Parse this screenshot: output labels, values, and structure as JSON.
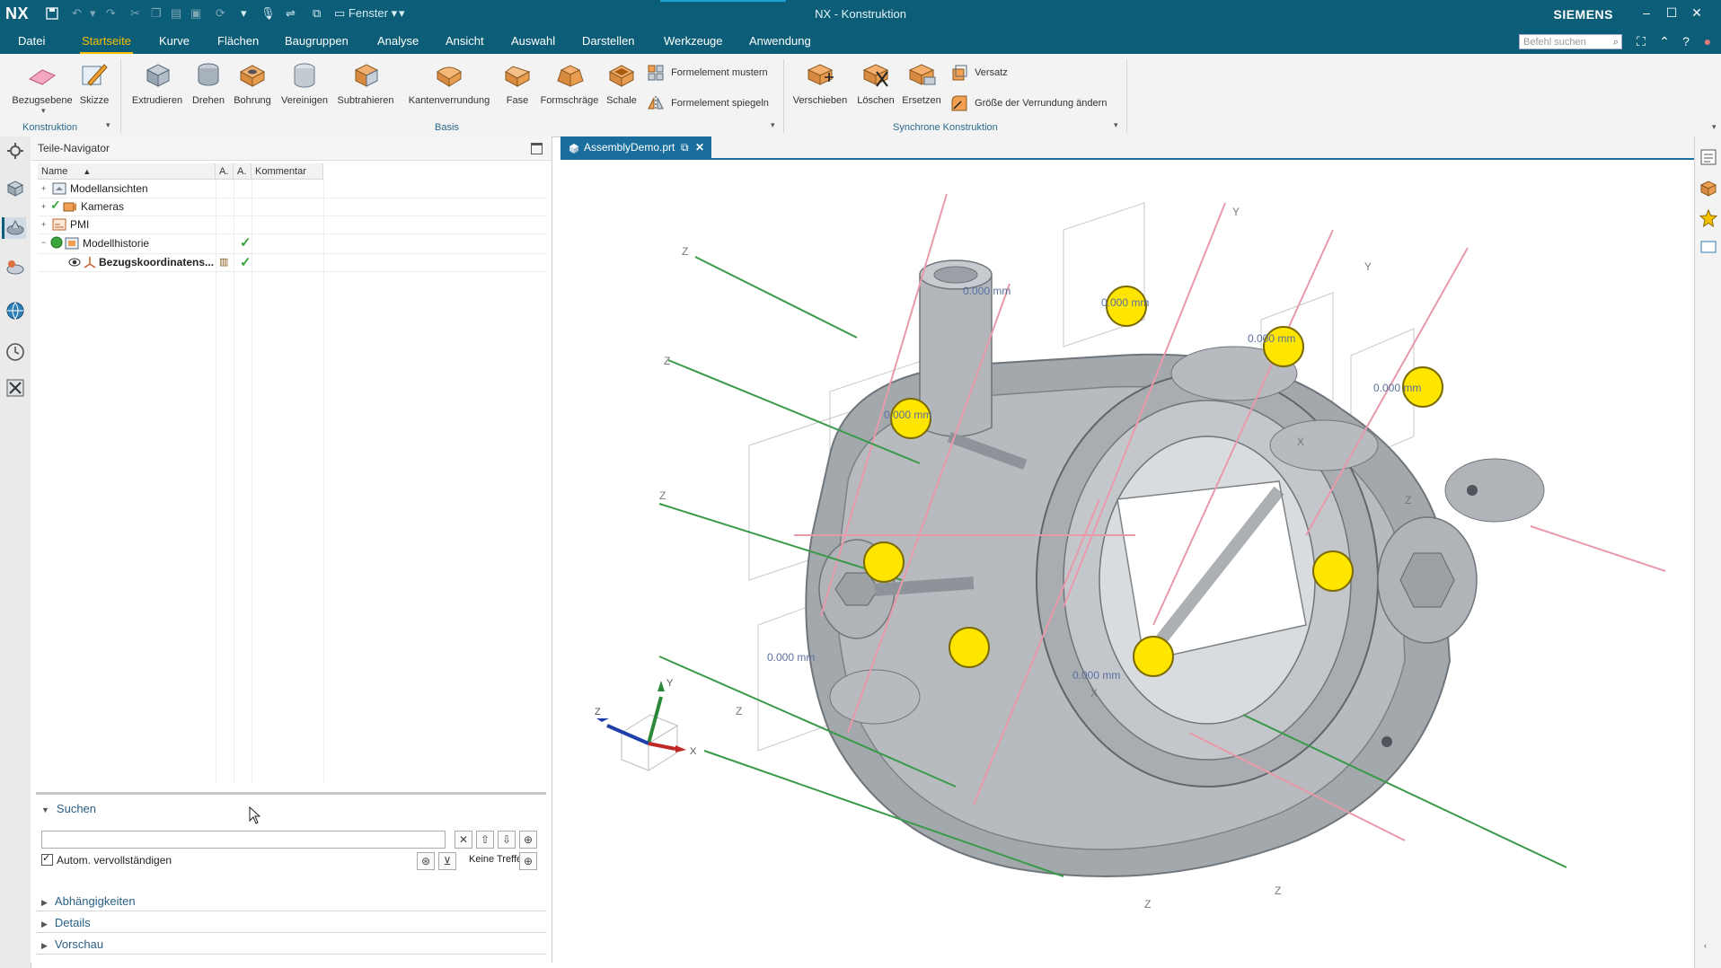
{
  "window": {
    "app_logo": "NX",
    "title": "NX - Konstruktion",
    "brand": "SIEMENS",
    "window_menu_label": "Fenster"
  },
  "menubar": {
    "items": [
      "Datei",
      "Startseite",
      "Kurve",
      "Flächen",
      "Baugruppen",
      "Analyse",
      "Ansicht",
      "Auswahl",
      "Darstellen",
      "Werkzeuge",
      "Anwendung"
    ],
    "active": "Startseite",
    "command_search_placeholder": "Befehl suchen"
  },
  "ribbon": {
    "groups": {
      "konstruktion": "Konstruktion",
      "basis": "Basis",
      "synchron": "Synchrone Konstruktion"
    },
    "buttons": {
      "bezugsebene": "Bezugsebene",
      "skizze": "Skizze",
      "extrudieren": "Extrudieren",
      "drehen": "Drehen",
      "bohrung": "Bohrung",
      "vereinigen": "Vereinigen",
      "subtrahieren": "Subtrahieren",
      "kantenverrundung": "Kantenverrundung",
      "fase": "Fase",
      "formschraege": "Formschräge",
      "schale": "Schale",
      "formelement_mustern": "Formelement mustern",
      "formelement_spiegeln": "Formelement spiegeln",
      "verschieben": "Verschieben",
      "loeschen": "Löschen",
      "ersetzen": "Ersetzen",
      "versatz": "Versatz",
      "groesse_verrundung": "Größe der Verrundung ändern"
    }
  },
  "navigator": {
    "title": "Teile-Navigator",
    "columns": [
      "Name",
      "A.",
      "A.",
      "Kommentar"
    ],
    "rows": [
      {
        "label": "Modellansichten",
        "checked": false,
        "bold": false
      },
      {
        "label": "Kameras",
        "checked": false,
        "bold": false
      },
      {
        "label": "PMI",
        "checked": false,
        "bold": false
      },
      {
        "label": "Modellhistorie",
        "checked": true,
        "bold": false
      },
      {
        "label": "Bezugskoordinatens...",
        "checked": true,
        "bold": true
      }
    ]
  },
  "search_panel": {
    "title": "Suchen",
    "autocomplete_label": "Autom. vervollständigen",
    "no_hits": "Keine Treffer",
    "sections": [
      "Abhängigkeiten",
      "Details",
      "Vorschau"
    ]
  },
  "viewport": {
    "tab_label": "AssemblyDemo.prt",
    "dimension_label": "0.000 mm",
    "axis_labels": {
      "x": "X",
      "y": "Y",
      "z": "Z"
    }
  },
  "colors": {
    "titlebar": "#0b5d78",
    "accent_yellow": "#f5c000",
    "tab_active": "#1a6e9e",
    "part_gray": "#a9adb1",
    "marker_yellow": "#ffe600"
  }
}
